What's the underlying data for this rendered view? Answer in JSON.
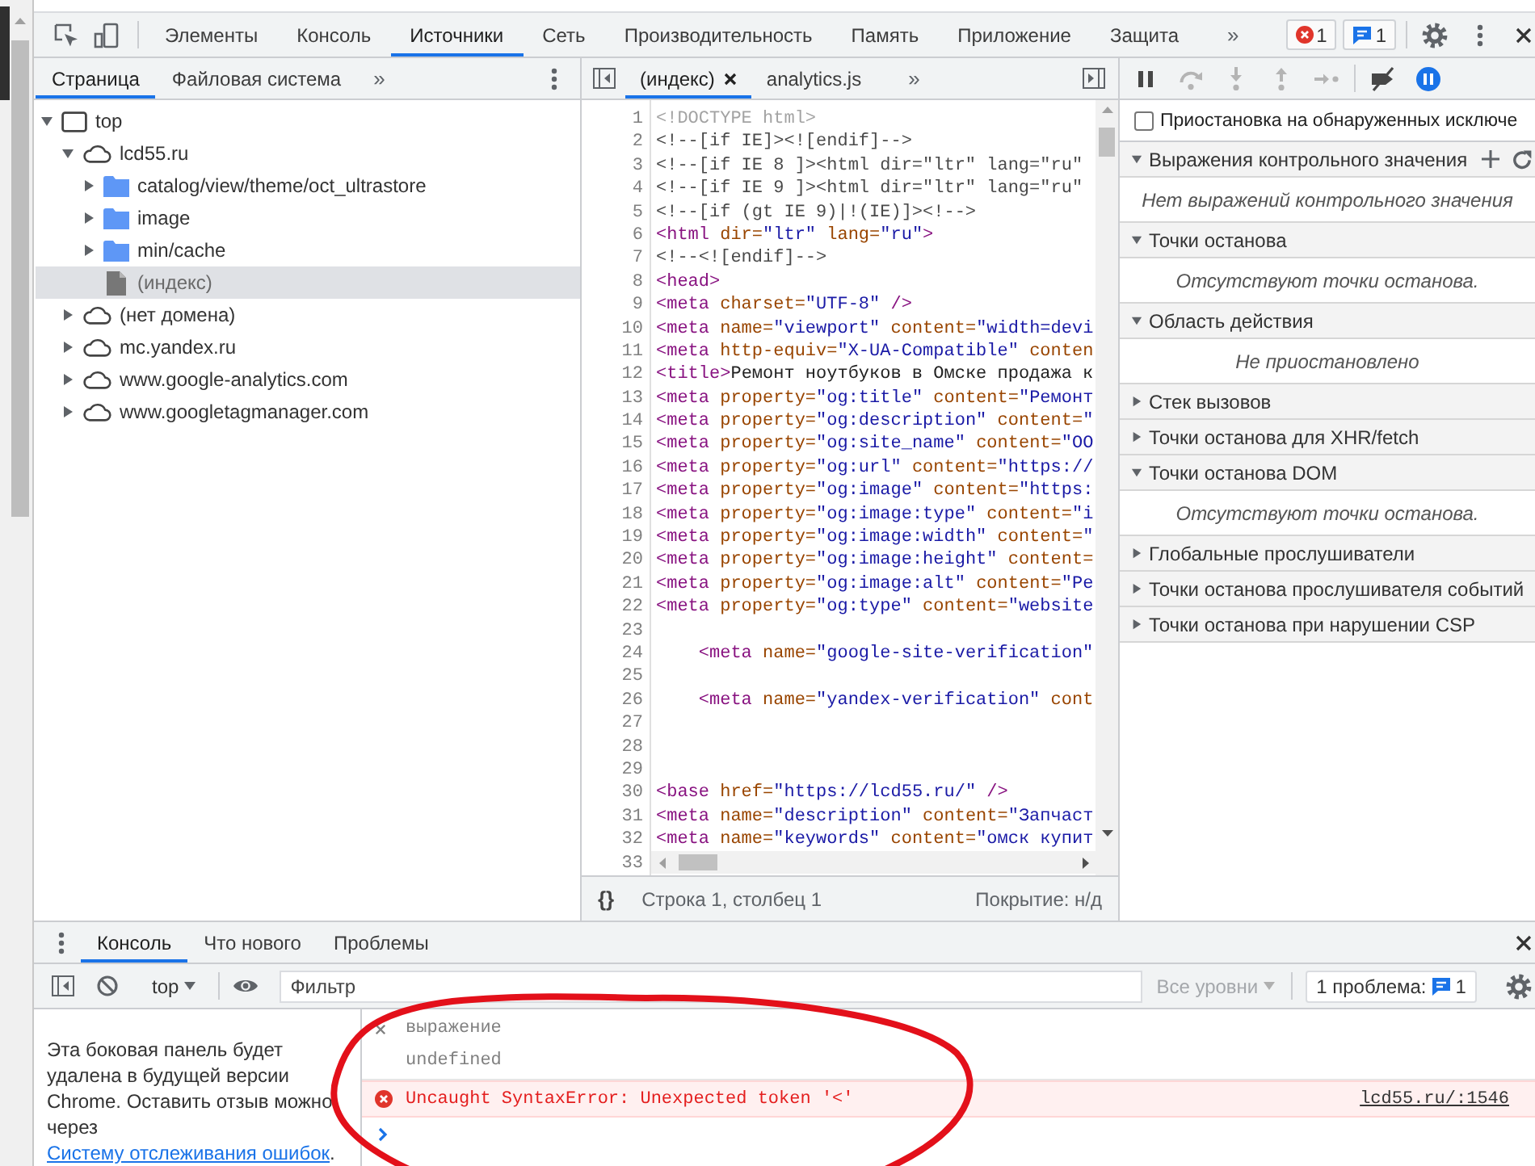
{
  "main_toolbar": {
    "tabs": [
      {
        "label": "Элементы",
        "selected": false
      },
      {
        "label": "Консоль",
        "selected": false
      },
      {
        "label": "Источники",
        "selected": true
      },
      {
        "label": "Сеть",
        "selected": false
      },
      {
        "label": "Производительность",
        "selected": false
      },
      {
        "label": "Память",
        "selected": false
      },
      {
        "label": "Приложение",
        "selected": false
      },
      {
        "label": "Защита",
        "selected": false
      }
    ],
    "overflow": "»",
    "error_count": "1",
    "issue_count": "1"
  },
  "navigator": {
    "tabs": [
      {
        "label": "Страница",
        "selected": true
      },
      {
        "label": "Файловая система",
        "selected": false
      }
    ],
    "overflow": "»",
    "tree": [
      {
        "label": "top",
        "kind": "frame",
        "expanded": true,
        "selected": false,
        "children": [
          {
            "label": "lcd55.ru",
            "kind": "domain",
            "expanded": true,
            "selected": false,
            "children": [
              {
                "label": "catalog/view/theme/oct_ultrastore",
                "kind": "folder",
                "expanded": false,
                "selected": false
              },
              {
                "label": "image",
                "kind": "folder",
                "expanded": false,
                "selected": false
              },
              {
                "label": "min/cache",
                "kind": "folder",
                "expanded": false,
                "selected": false
              },
              {
                "label": "(индекс)",
                "kind": "file",
                "selected": true
              }
            ]
          },
          {
            "label": "(нет домена)",
            "kind": "domain",
            "expanded": false,
            "selected": false
          },
          {
            "label": "mc.yandex.ru",
            "kind": "domain",
            "expanded": false,
            "selected": false
          },
          {
            "label": "www.google-analytics.com",
            "kind": "domain",
            "expanded": false,
            "selected": false
          },
          {
            "label": "www.googletagmanager.com",
            "kind": "domain",
            "expanded": false,
            "selected": false
          }
        ]
      }
    ]
  },
  "editor": {
    "tabs": [
      {
        "label": "(индекс)",
        "selected": true,
        "closable": true
      },
      {
        "label": "analytics.js",
        "selected": false,
        "closable": false
      }
    ],
    "overflow": "»",
    "lines": [
      {
        "number": "1",
        "tokens": [
          {
            "kind": "doctype",
            "text": "<!DOCTYPE html>"
          }
        ]
      },
      {
        "number": "2",
        "tokens": [
          {
            "kind": "comment",
            "text": "<!--[if IE]><![endif]-->"
          }
        ]
      },
      {
        "number": "3",
        "tokens": [
          {
            "kind": "comment",
            "text": "<!--[if IE 8 ]><html dir=\"ltr\" lang=\"ru\""
          }
        ]
      },
      {
        "number": "4",
        "tokens": [
          {
            "kind": "comment",
            "text": "<!--[if IE 9 ]><html dir=\"ltr\" lang=\"ru\""
          }
        ]
      },
      {
        "number": "5",
        "tokens": [
          {
            "kind": "comment",
            "text": "<!--[if (gt IE 9)|!(IE)]><!-->"
          }
        ]
      },
      {
        "number": "6",
        "tokens": [
          {
            "kind": "tag",
            "text": "<html "
          },
          {
            "kind": "attr",
            "text": "dir="
          },
          {
            "kind": "value",
            "text": "\"ltr\" "
          },
          {
            "kind": "attr",
            "text": "lang="
          },
          {
            "kind": "value",
            "text": "\"ru\""
          },
          {
            "kind": "tag",
            "text": ">"
          }
        ]
      },
      {
        "number": "7",
        "tokens": [
          {
            "kind": "comment",
            "text": "<!--<![endif]-->"
          }
        ]
      },
      {
        "number": "8",
        "tokens": [
          {
            "kind": "tag",
            "text": "<head>"
          }
        ]
      },
      {
        "number": "9",
        "tokens": [
          {
            "kind": "tag",
            "text": "<meta "
          },
          {
            "kind": "attr",
            "text": "charset="
          },
          {
            "kind": "value",
            "text": "\"UTF-8\" "
          },
          {
            "kind": "tag",
            "text": "/>"
          }
        ]
      },
      {
        "number": "10",
        "tokens": [
          {
            "kind": "tag",
            "text": "<meta "
          },
          {
            "kind": "attr",
            "text": "name="
          },
          {
            "kind": "value",
            "text": "\"viewport\" "
          },
          {
            "kind": "attr",
            "text": "content="
          },
          {
            "kind": "value",
            "text": "\"width=devi"
          }
        ]
      },
      {
        "number": "11",
        "tokens": [
          {
            "kind": "tag",
            "text": "<meta "
          },
          {
            "kind": "attr",
            "text": "http-equiv="
          },
          {
            "kind": "value",
            "text": "\"X-UA-Compatible\" "
          },
          {
            "kind": "attr",
            "text": "conten"
          }
        ]
      },
      {
        "number": "12",
        "tokens": [
          {
            "kind": "tag",
            "text": "<title>"
          },
          {
            "kind": "text",
            "text": "Ремонт ноутбуков в Омске продажа к"
          }
        ]
      },
      {
        "number": "13",
        "tokens": [
          {
            "kind": "tag",
            "text": "<meta "
          },
          {
            "kind": "attr",
            "text": "property="
          },
          {
            "kind": "value",
            "text": "\"og:title\" "
          },
          {
            "kind": "attr",
            "text": "content="
          },
          {
            "kind": "value",
            "text": "\"Ремонт"
          }
        ]
      },
      {
        "number": "14",
        "tokens": [
          {
            "kind": "tag",
            "text": "<meta "
          },
          {
            "kind": "attr",
            "text": "property="
          },
          {
            "kind": "value",
            "text": "\"og:description\" "
          },
          {
            "kind": "attr",
            "text": "content="
          },
          {
            "kind": "value",
            "text": "\""
          }
        ]
      },
      {
        "number": "15",
        "tokens": [
          {
            "kind": "tag",
            "text": "<meta "
          },
          {
            "kind": "attr",
            "text": "property="
          },
          {
            "kind": "value",
            "text": "\"og:site_name\" "
          },
          {
            "kind": "attr",
            "text": "content="
          },
          {
            "kind": "value",
            "text": "\"ОО"
          }
        ]
      },
      {
        "number": "16",
        "tokens": [
          {
            "kind": "tag",
            "text": "<meta "
          },
          {
            "kind": "attr",
            "text": "property="
          },
          {
            "kind": "value",
            "text": "\"og:url\" "
          },
          {
            "kind": "attr",
            "text": "content="
          },
          {
            "kind": "value",
            "text": "\"https://"
          }
        ]
      },
      {
        "number": "17",
        "tokens": [
          {
            "kind": "tag",
            "text": "<meta "
          },
          {
            "kind": "attr",
            "text": "property="
          },
          {
            "kind": "value",
            "text": "\"og:image\" "
          },
          {
            "kind": "attr",
            "text": "content="
          },
          {
            "kind": "value",
            "text": "\"https:"
          }
        ]
      },
      {
        "number": "18",
        "tokens": [
          {
            "kind": "tag",
            "text": "<meta "
          },
          {
            "kind": "attr",
            "text": "property="
          },
          {
            "kind": "value",
            "text": "\"og:image:type\" "
          },
          {
            "kind": "attr",
            "text": "content="
          },
          {
            "kind": "value",
            "text": "\"i"
          }
        ]
      },
      {
        "number": "19",
        "tokens": [
          {
            "kind": "tag",
            "text": "<meta "
          },
          {
            "kind": "attr",
            "text": "property="
          },
          {
            "kind": "value",
            "text": "\"og:image:width\" "
          },
          {
            "kind": "attr",
            "text": "content="
          },
          {
            "kind": "value",
            "text": "\""
          }
        ]
      },
      {
        "number": "20",
        "tokens": [
          {
            "kind": "tag",
            "text": "<meta "
          },
          {
            "kind": "attr",
            "text": "property="
          },
          {
            "kind": "value",
            "text": "\"og:image:height\" "
          },
          {
            "kind": "attr",
            "text": "content="
          }
        ]
      },
      {
        "number": "21",
        "tokens": [
          {
            "kind": "tag",
            "text": "<meta "
          },
          {
            "kind": "attr",
            "text": "property="
          },
          {
            "kind": "value",
            "text": "\"og:image:alt\" "
          },
          {
            "kind": "attr",
            "text": "content="
          },
          {
            "kind": "value",
            "text": "\"Ре"
          }
        ]
      },
      {
        "number": "22",
        "tokens": [
          {
            "kind": "tag",
            "text": "<meta "
          },
          {
            "kind": "attr",
            "text": "property="
          },
          {
            "kind": "value",
            "text": "\"og:type\" "
          },
          {
            "kind": "attr",
            "text": "content="
          },
          {
            "kind": "value",
            "text": "\"website"
          }
        ]
      },
      {
        "number": "23"
      },
      {
        "number": "24",
        "tokens": [
          {
            "kind": "tag",
            "text": "    <meta "
          },
          {
            "kind": "attr",
            "text": "name="
          },
          {
            "kind": "value",
            "text": "\"google-site-verification\""
          }
        ]
      },
      {
        "number": "25"
      },
      {
        "number": "26",
        "tokens": [
          {
            "kind": "tag",
            "text": "    <meta "
          },
          {
            "kind": "attr",
            "text": "name="
          },
          {
            "kind": "value",
            "text": "\"yandex-verification\" "
          },
          {
            "kind": "attr",
            "text": "cont"
          }
        ]
      },
      {
        "number": "27"
      },
      {
        "number": "28"
      },
      {
        "number": "29"
      },
      {
        "number": "30",
        "tokens": [
          {
            "kind": "tag",
            "text": "<base "
          },
          {
            "kind": "attr",
            "text": "href="
          },
          {
            "kind": "value",
            "text": "\"https://lcd55.ru/\" "
          },
          {
            "kind": "tag",
            "text": "/>"
          }
        ]
      },
      {
        "number": "31",
        "tokens": [
          {
            "kind": "tag",
            "text": "<meta "
          },
          {
            "kind": "attr",
            "text": "name="
          },
          {
            "kind": "value",
            "text": "\"description\" "
          },
          {
            "kind": "attr",
            "text": "content="
          },
          {
            "kind": "value",
            "text": "\"Запчаст"
          }
        ]
      },
      {
        "number": "32",
        "tokens": [
          {
            "kind": "tag",
            "text": "<meta "
          },
          {
            "kind": "attr",
            "text": "name="
          },
          {
            "kind": "value",
            "text": "\"keywords\" "
          },
          {
            "kind": "attr",
            "text": "content="
          },
          {
            "kind": "value",
            "text": "\"омск купит"
          }
        ]
      },
      {
        "number": "33"
      }
    ],
    "status": {
      "format_button": "{}",
      "position": "Строка 1, столбец 1",
      "coverage": "Покрытие: н/д"
    }
  },
  "debugger": {
    "controls": [
      {
        "kind": "pause",
        "disabled": false,
        "active": false
      },
      {
        "kind": "step-over",
        "disabled": true,
        "active": false
      },
      {
        "kind": "step-into",
        "disabled": true,
        "active": false
      },
      {
        "kind": "step-out",
        "disabled": true,
        "active": false
      },
      {
        "kind": "step",
        "disabled": true,
        "active": false
      },
      {
        "kind": "deactivate-breakpoints",
        "disabled": false,
        "active": false
      },
      {
        "kind": "pause-on-exceptions",
        "disabled": false,
        "active": true
      }
    ],
    "pause_on_caught": {
      "label": "Приостановка на обнаруженных исключе",
      "checked": false
    },
    "sections": [
      {
        "kind": "watch",
        "title": "Выражения контрольного значения",
        "expanded": true,
        "message": "Нет выражений контрольного значения"
      },
      {
        "kind": "pane",
        "title": "Точки останова",
        "expanded": true,
        "message": "Отсутствуют точки останова."
      },
      {
        "kind": "pane",
        "title": "Область действия",
        "expanded": true,
        "message": "Не приостановлено"
      },
      {
        "kind": "pane",
        "title": "Стек вызовов",
        "expanded": false
      },
      {
        "kind": "pane",
        "title": "Точки останова для XHR/fetch",
        "expanded": false
      },
      {
        "kind": "pane",
        "title": "Точки останова DOM",
        "expanded": true,
        "message": "Отсутствуют точки останова."
      },
      {
        "kind": "pane",
        "title": "Глобальные прослушиватели",
        "expanded": false
      },
      {
        "kind": "pane",
        "title": "Точки останова прослушивателя событий",
        "expanded": false
      },
      {
        "kind": "pane",
        "title": "Точки останова при нарушении CSP",
        "expanded": false
      }
    ]
  },
  "drawer": {
    "tabs": [
      {
        "label": "Консоль",
        "selected": true
      },
      {
        "label": "Что нового",
        "selected": false
      },
      {
        "label": "Проблемы",
        "selected": false
      }
    ],
    "console_toolbar": {
      "context": "top",
      "filter_placeholder": "Фильтр",
      "levels": {
        "label": "Все уровни",
        "disabled": true
      },
      "issues": {
        "label": "1 проблема:",
        "count": "1"
      }
    },
    "sidebar_notice": {
      "text": "Эта боковая панель будет удалена в будущей версии Chrome. Оставить отзыв можно через",
      "link": "Систему отслеживания ошибок",
      "end": "."
    },
    "live_expression": {
      "expression": "выражение",
      "value": "undefined"
    },
    "messages": [
      {
        "kind": "error",
        "text": "Uncaught SyntaxError: Unexpected token '<'",
        "source": "lcd55.ru/:1546"
      }
    ]
  }
}
